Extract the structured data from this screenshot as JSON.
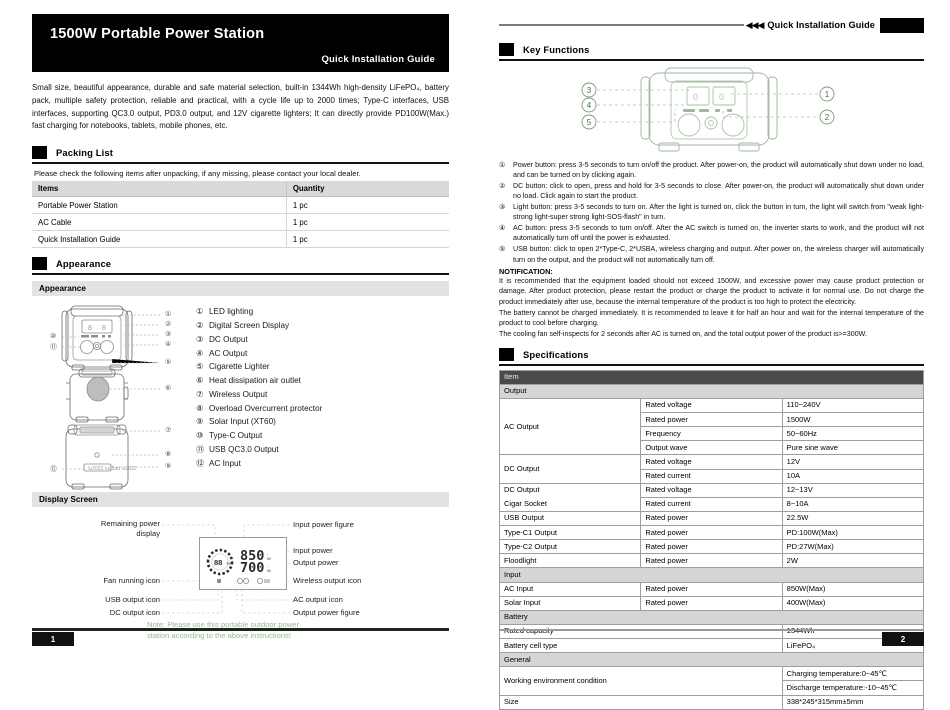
{
  "left": {
    "banner": {
      "title": "1500W Portable Power Station",
      "subtitle": "Quick Installation Guide"
    },
    "intro": "Small size, beautiful appearance, durable and safe material selection, built-in 1344Wh high-density LiFePO₄, battery pack, multiple safety protection, reliable and practical, with a cycle life up to 2000 times; Type-C interfaces, USB interfaces, supporting QC3.0 output, PD3.0 output, and 12V cigarette lighters; It can directly provide PD100W(Max.) fast charging for notebooks, tablets, mobile phones, etc.",
    "packing": {
      "heading": "Packing List",
      "note": "Please check the following items after unpacking, if any missing, please contact your local dealer.",
      "columns": [
        "Items",
        "Quantity"
      ],
      "rows": [
        [
          "Portable Power Station",
          "1 pc"
        ],
        [
          "AC Cable",
          "1 pc"
        ],
        [
          "Quick Installation Guide",
          "1 pc"
        ]
      ]
    },
    "appearance": {
      "heading": "Appearance",
      "subbar": "Appearance",
      "items": [
        {
          "num": "①",
          "label": "LED lighting"
        },
        {
          "num": "②",
          "label": "Digital Screen Display"
        },
        {
          "num": "③",
          "label": "DC Output"
        },
        {
          "num": "④",
          "label": "AC Output"
        },
        {
          "num": "⑤",
          "label": "Cigarette Lighter"
        },
        {
          "num": "⑥",
          "label": "Heat dissipation air outlet"
        },
        {
          "num": "⑦",
          "label": "Wireless Output"
        },
        {
          "num": "⑧",
          "label": "Overload Overcurrent protector"
        },
        {
          "num": "⑨",
          "label": "Solar Input (XT60)"
        },
        {
          "num": "⑩",
          "label": "Type-C Output"
        },
        {
          "num": "⑪",
          "label": "USB QC3.0 Output"
        },
        {
          "num": "⑫",
          "label": "AC Input"
        }
      ],
      "figure_callouts": [
        "①",
        "②",
        "③",
        "④",
        "⑤",
        "⑥",
        "⑦",
        "⑧",
        "⑨",
        "⑩",
        "⑪",
        "⑫"
      ]
    },
    "display_screen": {
      "subbar": "Display Screen",
      "labels_left": [
        "Remaining power\ndisplay",
        "Fan running icon",
        "USB output icon",
        "DC output icon"
      ],
      "labels_right": [
        "Input power figure",
        "Input power",
        "Output power",
        "Wireless output icon",
        "AC output icon",
        "Output power figure"
      ],
      "lcd": {
        "battery_percent": "88",
        "percent_symbol": "%",
        "input_value": "850",
        "input_unit": "W",
        "output_value": "700",
        "output_unit": "W"
      },
      "green_note": "Note: Please use this portable outdoor power\n        station according to the above instructions!"
    },
    "page_number": "1"
  },
  "right": {
    "header": {
      "arrows": "◀◀◀",
      "title": "Quick Installation Guide"
    },
    "key_functions": {
      "heading": "Key Functions",
      "figure_callouts": [
        "①",
        "②",
        "③",
        "④",
        "⑤"
      ],
      "items": [
        {
          "num": "①",
          "text": "Power button: press 3-5 seconds to turn on/off the product. After power-on, the product will automatically shut down under no load, and can be turned on by clicking again."
        },
        {
          "num": "②",
          "text": "DC button: click to open, press and hold for 3-5 seconds to close. After power-on, the product will automatically shut down under no load. Click again to start the product."
        },
        {
          "num": "③",
          "text": "Light button: press 3-5 seconds to turn on. After the light is turned on, click the button in turn, the light will switch from \"weak light-strong light-super strong light-SOS-flash\" in turn."
        },
        {
          "num": "④",
          "text": "AC button: press 3-5 seconds to turn on/off. After the AC switch is turned on, the inverter starts to work, and the product will not automatically turn off until the power is exhausted."
        },
        {
          "num": "⑤",
          "text": "USB button: click to open 2*Type-C, 2*USBA, wireless charging and output. After power on, the wireless charger will automatically turn on the output, and the product will not automatically turn off."
        }
      ],
      "notification_heading": "NOTIFICATION:",
      "notification_paragraphs": [
        "It is recommended that the equipment loaded should not exceed 1500W, and excessive power may cause product protection or damage. After product protection, please restart the product or charge the product to activate it for normal use. Do not charge the product immediately after use, because the internal temperature of the product is too high to protect the electricity.",
        "The battery cannot be charged immediately. It is recommended to leave it for half an hour and wait for the internal temperature of the product to cool before charging.",
        "The cooling fan self-inspects for 2 seconds after AC is turned on, and the total output power of the product is>=300W."
      ]
    },
    "specifications": {
      "heading": "Specifications",
      "header_row": "Item",
      "rows": [
        {
          "kind": "group",
          "label": "Output"
        },
        {
          "kind": "data",
          "name": "AC Output",
          "rowspan": 4,
          "param": "Rated voltage",
          "value": "110~240V"
        },
        {
          "kind": "data",
          "param": "Rated power",
          "value": "1500W"
        },
        {
          "kind": "data",
          "param": "Frequency",
          "value": "50~60Hz"
        },
        {
          "kind": "data",
          "param": "Output wave",
          "value": "Pure sine wave"
        },
        {
          "kind": "data",
          "name": "DC Output",
          "rowspan": 2,
          "param": "Rated voltage",
          "value": "12V"
        },
        {
          "kind": "data",
          "param": "Rated current",
          "value": "10A"
        },
        {
          "kind": "data",
          "name": "DC Output",
          "param": "Rated voltage",
          "value": "12~13V"
        },
        {
          "kind": "data",
          "name": "Cigar Socket",
          "param": "Rated current",
          "value": "8~10A"
        },
        {
          "kind": "data",
          "name": "USB Output",
          "param": "Rated power",
          "value": "22.5W"
        },
        {
          "kind": "data",
          "name": "Type-C1 Output",
          "param": "Rated power",
          "value": "PD:100W(Max)"
        },
        {
          "kind": "data",
          "name": "Type-C2 Output",
          "param": "Rated power",
          "value": "PD:27W(Max)"
        },
        {
          "kind": "data",
          "name": "Floodlight",
          "param": "Rated power",
          "value": "2W"
        },
        {
          "kind": "group",
          "label": "Input"
        },
        {
          "kind": "data",
          "name": "AC Input",
          "param": "Rated power",
          "value": "850W(Max)"
        },
        {
          "kind": "data",
          "name": "Solar Input",
          "param": "Rated power",
          "value": "400W(Max)"
        },
        {
          "kind": "group",
          "label": "Battery"
        },
        {
          "kind": "wide",
          "name": "Rated capacity",
          "value": "1344Wh"
        },
        {
          "kind": "wide",
          "name": "Battery cell type",
          "value": "LiFePO₄"
        },
        {
          "kind": "group",
          "label": "General"
        },
        {
          "kind": "wide",
          "name": "Working environment condition",
          "rowspan": 2,
          "value": "Charging temperature:0~45℃"
        },
        {
          "kind": "wide",
          "value": "Discharge temperature:-10~45℃"
        },
        {
          "kind": "wide",
          "name": "Size",
          "value": "338*245*315mm±5mm"
        }
      ]
    },
    "page_number": "2"
  }
}
